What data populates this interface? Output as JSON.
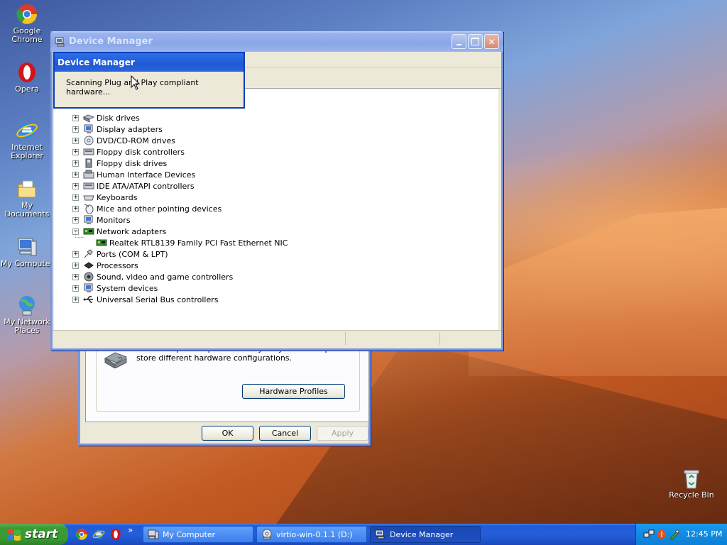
{
  "desktop": {
    "icons": [
      {
        "label": "Google Chrome",
        "icon": "chrome-icon"
      },
      {
        "label": "Opera",
        "icon": "opera-icon"
      },
      {
        "label": "Internet Explorer",
        "icon": "ie-icon"
      },
      {
        "label": "My Documents",
        "icon": "folder-docs-icon"
      },
      {
        "label": "My Computer",
        "icon": "computer-icon"
      },
      {
        "label": "My Network Places",
        "icon": "network-icon"
      },
      {
        "label": "Recycle Bin",
        "icon": "recycle-bin-icon"
      }
    ]
  },
  "system_properties": {
    "hardware_profiles_text": "Hardware profiles provide a way for you to set up and store different hardware configurations.",
    "hardware_profiles_button": "Hardware Profiles",
    "ok": "OK",
    "cancel": "Cancel",
    "apply": "Apply"
  },
  "device_manager": {
    "title": "Device Manager",
    "devices": [
      {
        "label": "Disk drives",
        "expanded": false
      },
      {
        "label": "Display adapters",
        "expanded": false
      },
      {
        "label": "DVD/CD-ROM drives",
        "expanded": false
      },
      {
        "label": "Floppy disk controllers",
        "expanded": false
      },
      {
        "label": "Floppy disk drives",
        "expanded": false
      },
      {
        "label": "Human Interface Devices",
        "expanded": false
      },
      {
        "label": "IDE ATA/ATAPI controllers",
        "expanded": false
      },
      {
        "label": "Keyboards",
        "expanded": false
      },
      {
        "label": "Mice and other pointing devices",
        "expanded": false
      },
      {
        "label": "Monitors",
        "expanded": false
      },
      {
        "label": "Network adapters",
        "expanded": true
      },
      {
        "label": "Realtek RTL8139 Family PCI Fast Ethernet NIC",
        "child": true
      },
      {
        "label": "Ports (COM & LPT)",
        "expanded": false
      },
      {
        "label": "Processors",
        "expanded": false
      },
      {
        "label": "Sound, video and game controllers",
        "expanded": false
      },
      {
        "label": "System devices",
        "expanded": false
      },
      {
        "label": "Universal Serial Bus controllers",
        "expanded": false
      }
    ]
  },
  "scan_popup": {
    "title": "Device Manager",
    "message": "Scanning Plug and Play compliant hardware..."
  },
  "taskbar": {
    "start_label": "start",
    "items": [
      {
        "label": "My Computer",
        "active": false
      },
      {
        "label": "virtio-win-0.1.1 (D:)",
        "active": false
      },
      {
        "label": "Device Manager",
        "active": true
      }
    ],
    "clock": "12:45 PM",
    "expand_arrow": "»"
  }
}
